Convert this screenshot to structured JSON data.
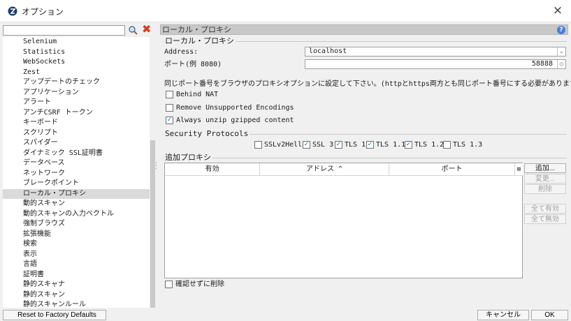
{
  "window": {
    "title": "オプション",
    "close": "×"
  },
  "left": {
    "search_value": "",
    "tree_items": [
      "Selenium",
      "Statistics",
      "WebSockets",
      "Zest",
      "アップデートのチェック",
      "アプリケーション",
      "アラート",
      "アンチCSRF トークン",
      "キーボード",
      "スクリプト",
      "スパイダー",
      "ダイナミック SSL証明書",
      "データベース",
      "ネットワーク",
      "ブレークポイント",
      "ローカル・プロキシ",
      "動的スキャン",
      "動的スキャンの入力ベクトル",
      "強制ブラウズ",
      "拡張機能",
      "検索",
      "表示",
      "言語",
      "証明書",
      "静的スキャナ",
      "静的スキャン",
      "静的スキャンルール"
    ],
    "selected_index": 15,
    "reset_button": "Reset to Factory Defaults"
  },
  "right": {
    "header": "ローカル・プロキシ",
    "help": "?",
    "group1_title": "ローカル・プロキシ",
    "address_label": "Address:",
    "address_value": "localhost",
    "port_label": "ポート(例 8080)",
    "port_value": "58888",
    "info_text": "同じポート番号をブラウザのプロキシオプションに設定して下さい。(httpとhttps両方とも同じポート番号にする必要があります)",
    "behind_nat": {
      "label": "Behind NAT",
      "checked": false
    },
    "remove_encodings": {
      "label": "Remove Unsupported Encodings",
      "checked": false
    },
    "always_unzip": {
      "label": "Always unzip gzipped content",
      "checked": true
    },
    "security_title": "Security Protocols",
    "protocols": [
      {
        "label": "SSLv2Hello",
        "checked": false
      },
      {
        "label": "SSL 3",
        "checked": true
      },
      {
        "label": "TLS 1",
        "checked": true
      },
      {
        "label": "TLS 1.1",
        "checked": true
      },
      {
        "label": "TLS 1.2",
        "checked": true
      },
      {
        "label": "TLS 1.3",
        "checked": false
      }
    ],
    "additional_title": "追加プロキシ",
    "table_headers": [
      "有効",
      "アドレス ^",
      "ポート"
    ],
    "buttons": {
      "add": "追加...",
      "modify": "変更...",
      "remove": "削除",
      "enable_all": "全て有効",
      "disable_all": "全て無効"
    },
    "confirm_remove": {
      "label": "確認せずに削除",
      "checked": false
    }
  },
  "footer": {
    "cancel": "キャンセル",
    "ok": "OK"
  },
  "colors": {
    "check": "#1e6fd0",
    "selected_row": "#dadada",
    "header_bg": "#c8c8c8"
  }
}
